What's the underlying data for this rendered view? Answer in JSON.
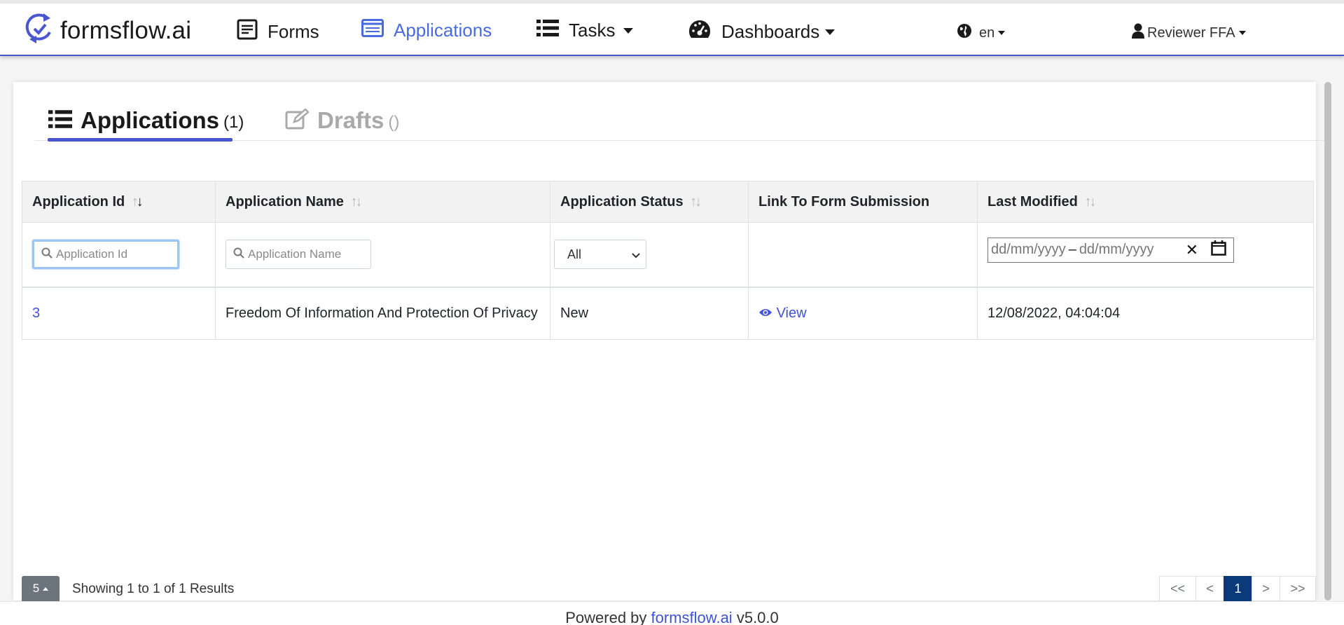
{
  "navbar": {
    "brand": "formsflow.ai",
    "items": [
      {
        "label": "Forms",
        "icon": "forms-icon"
      },
      {
        "label": "Applications",
        "icon": "applications-icon"
      },
      {
        "label": "Tasks",
        "icon": "list-icon"
      },
      {
        "label": "Dashboards",
        "icon": "dashboard-icon"
      }
    ],
    "language": "en",
    "user": "Reviewer FFA",
    "colors": {
      "accent": "#4a56d0",
      "active_link": "#4a6ae0"
    }
  },
  "tabs": [
    {
      "label": "Applications",
      "count": "(1)",
      "icon": "list-icon"
    },
    {
      "label": "Drafts",
      "count": "()",
      "icon": "edit-icon"
    }
  ],
  "table": {
    "headers": [
      "Application Id",
      "Application Name",
      "Application Status",
      "Link To Form Submission",
      "Last Modified"
    ],
    "filters": {
      "id_placeholder": "Application Id",
      "name_placeholder": "Application Name",
      "status_selected": "All",
      "date_from": "dd/mm/yyyy",
      "date_sep": "–",
      "date_to": "dd/mm/yyyy"
    },
    "rows": [
      {
        "id": "3",
        "name": "Freedom Of Information And Protection Of Privacy",
        "status": "New",
        "link": "View",
        "modified": "12/08/2022, 04:04:04"
      }
    ]
  },
  "pagination": {
    "page_size": "5",
    "showing": "Showing 1 to 1 of 1 Results",
    "buttons": [
      "<<",
      "<",
      "1",
      ">",
      ">>"
    ]
  },
  "footer": {
    "prefix": "Powered by",
    "link": "formsflow.ai",
    "version": "v5.0.0"
  }
}
